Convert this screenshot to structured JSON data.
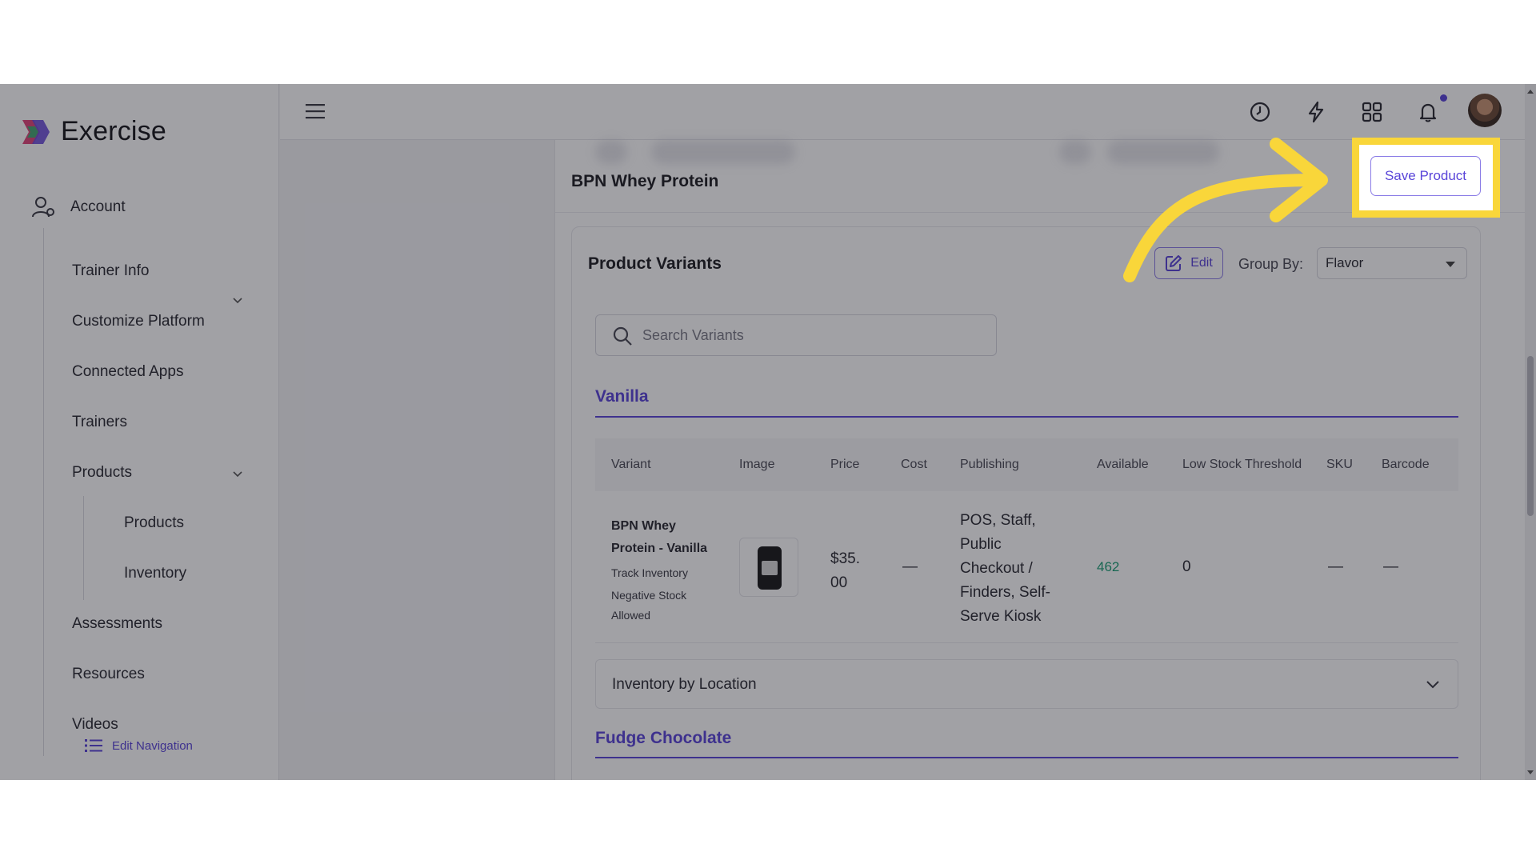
{
  "brand": {
    "name": "Exercise"
  },
  "sidebar": {
    "account_label": "Account",
    "items": [
      {
        "label": "Trainer Info"
      },
      {
        "label": "Customize Platform"
      },
      {
        "label": "Connected Apps"
      },
      {
        "label": "Trainers"
      },
      {
        "label": "Products"
      },
      {
        "label": "Assessments"
      },
      {
        "label": "Resources"
      },
      {
        "label": "Videos"
      }
    ],
    "product_subitems": [
      {
        "label": "Products"
      },
      {
        "label": "Inventory"
      }
    ],
    "edit_navigation_label": "Edit Navigation"
  },
  "topbar": {
    "icons": [
      "menu-icon",
      "clock-icon",
      "lightning-icon",
      "apps-grid-icon",
      "bell-icon"
    ]
  },
  "page": {
    "title": "BPN Whey Protein",
    "save_label": "Save Product"
  },
  "variants": {
    "title": "Product Variants",
    "edit_label": "Edit",
    "group_by_label": "Group By:",
    "group_by_value": "Flavor",
    "search_placeholder": "Search Variants",
    "columns": [
      "Variant",
      "Image",
      "Price",
      "Cost",
      "Publishing",
      "Available",
      "Low Stock Threshold",
      "SKU",
      "Barcode"
    ],
    "groups": [
      {
        "name": "Vanilla",
        "rows": [
          {
            "variant_line1": "BPN Whey",
            "variant_line2": "Protein - Vanilla",
            "track_inventory": "Track Inventory",
            "negative_stock_line1": "Negative Stock",
            "negative_stock_line2": "Allowed",
            "price_line1": "$35.",
            "price_line2": "00",
            "cost": "—",
            "publishing_lines": [
              "POS, Staff,",
              "Public",
              "Checkout /",
              "Finders, Self-",
              "Serve Kiosk"
            ],
            "available": "462",
            "low_stock_threshold": "0",
            "sku": "—",
            "barcode": "—"
          }
        ],
        "inventory_by_location_label": "Inventory by Location"
      },
      {
        "name": "Fudge Chocolate"
      }
    ]
  },
  "colors": {
    "accent": "#5a45d9",
    "highlight": "#f9d63a",
    "available": "#1b9e76"
  }
}
